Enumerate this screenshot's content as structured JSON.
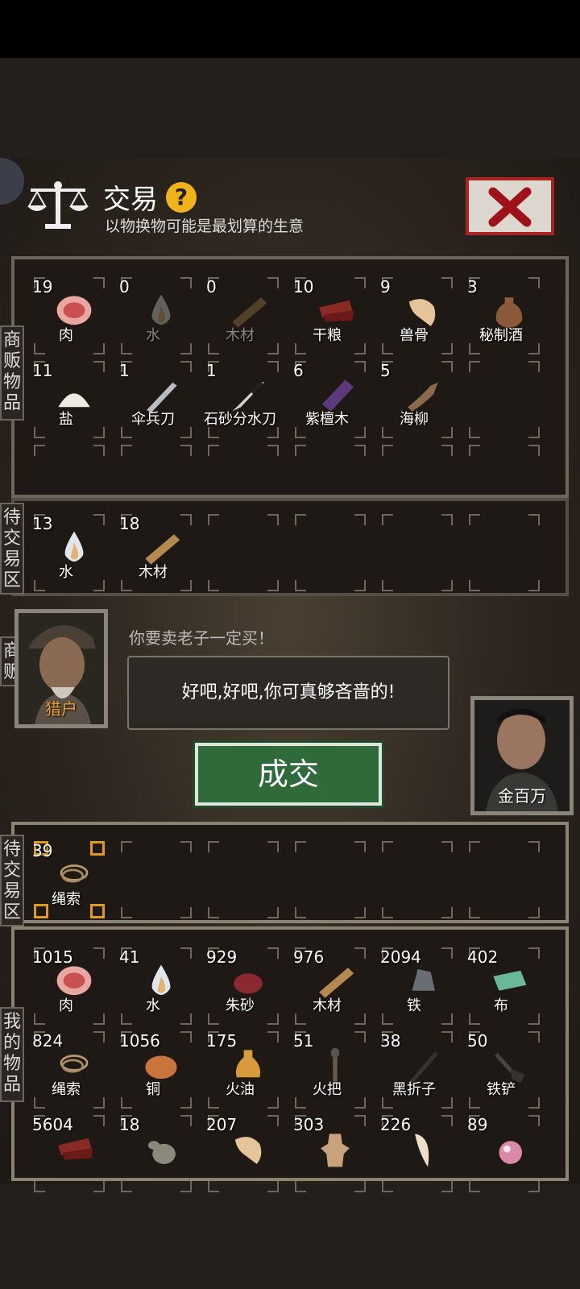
{
  "header": {
    "title": "交易",
    "help_label": "?",
    "subtitle": "以物换物可能是最划算的生意"
  },
  "labels": {
    "merchant_goods": "商贩物品",
    "merchant_pending": "待交易区",
    "merchant": "商贩",
    "my_pending": "待交易区",
    "my_goods": "我的物品"
  },
  "merchant": {
    "name": "猎户",
    "line": "你要卖老子一定买！",
    "speech": "好吧,好吧,你可真够吝啬的!"
  },
  "player": {
    "name": "金百万"
  },
  "deal_button_label": "成交",
  "merchant_goods": [
    {
      "count": "19",
      "name": "肉",
      "icon": "meat-icon"
    },
    {
      "count": "0",
      "name": "水",
      "icon": "water-drop-icon",
      "dim": true
    },
    {
      "count": "0",
      "name": "木材",
      "icon": "wood-plank-icon",
      "dim": true
    },
    {
      "count": "10",
      "name": "干粮",
      "icon": "jerky-icon"
    },
    {
      "count": "9",
      "name": "兽骨",
      "icon": "bone-icon"
    },
    {
      "count": "3",
      "name": "秘制酒",
      "icon": "wine-jug-icon"
    },
    {
      "count": "11",
      "name": "盐",
      "icon": "salt-pile-icon"
    },
    {
      "count": "1",
      "name": "伞兵刀",
      "icon": "paratrooper-knife-icon"
    },
    {
      "count": "1",
      "name": "石砂分水刀",
      "icon": "knife-icon"
    },
    {
      "count": "6",
      "name": "紫檀木",
      "icon": "rosewood-icon"
    },
    {
      "count": "5",
      "name": "海柳",
      "icon": "driftwood-icon"
    }
  ],
  "merchant_pending": [
    {
      "count": "13",
      "name": "水",
      "icon": "water-drop-icon"
    },
    {
      "count": "18",
      "name": "木材",
      "icon": "wood-plank-icon"
    }
  ],
  "my_pending": [
    {
      "count": "39",
      "name": "绳索",
      "icon": "rope-icon",
      "selected": true
    }
  ],
  "my_goods": [
    {
      "count": "1015",
      "name": "肉",
      "icon": "meat-icon"
    },
    {
      "count": "41",
      "name": "水",
      "icon": "water-drop-icon"
    },
    {
      "count": "929",
      "name": "朱砂",
      "icon": "cinnabar-icon"
    },
    {
      "count": "976",
      "name": "木材",
      "icon": "wood-plank-icon"
    },
    {
      "count": "2094",
      "name": "铁",
      "icon": "iron-ore-icon"
    },
    {
      "count": "402",
      "name": "布",
      "icon": "cloth-icon"
    },
    {
      "count": "824",
      "name": "绳索",
      "icon": "rope-icon"
    },
    {
      "count": "1056",
      "name": "铜",
      "icon": "copper-ore-icon"
    },
    {
      "count": "175",
      "name": "火油",
      "icon": "oil-bottle-icon"
    },
    {
      "count": "51",
      "name": "火把",
      "icon": "torch-icon"
    },
    {
      "count": "38",
      "name": "黑折子",
      "icon": "black-stick-icon"
    },
    {
      "count": "50",
      "name": "铁铲",
      "icon": "shovel-icon"
    },
    {
      "count": "5604",
      "name": "",
      "icon": "jerky-icon"
    },
    {
      "count": "18",
      "name": "",
      "icon": "gourd-icon"
    },
    {
      "count": "207",
      "name": "",
      "icon": "bone-icon"
    },
    {
      "count": "303",
      "name": "",
      "icon": "animal-hide-icon"
    },
    {
      "count": "226",
      "name": "",
      "icon": "fang-icon"
    },
    {
      "count": "89",
      "name": "",
      "icon": "pearl-icon"
    }
  ]
}
